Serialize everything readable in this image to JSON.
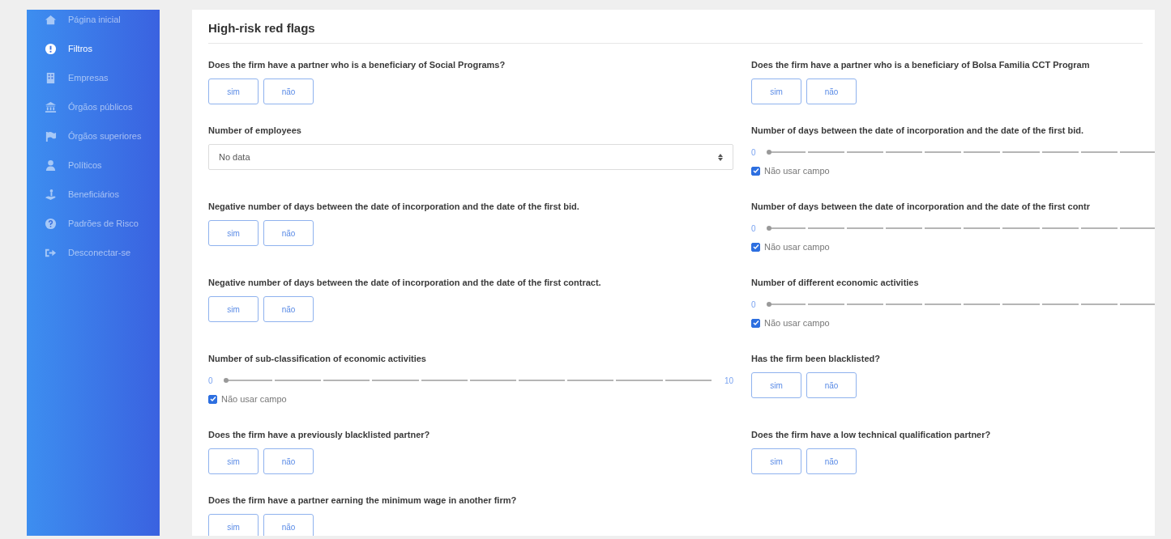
{
  "sidebar": {
    "items": [
      {
        "label": "Página inicial",
        "selected": false
      },
      {
        "label": "Filtros",
        "selected": true
      },
      {
        "label": "Empresas",
        "selected": false
      },
      {
        "label": "Órgãos públicos",
        "selected": false
      },
      {
        "label": "Órgãos superiores",
        "selected": false
      },
      {
        "label": "Políticos",
        "selected": false
      },
      {
        "label": "Beneficiários",
        "selected": false
      },
      {
        "label": "Padrões de Risco",
        "selected": false
      },
      {
        "label": "Desconectar-se",
        "selected": false
      }
    ]
  },
  "panel": {
    "title": "High-risk red flags",
    "left_column": [
      {
        "kind": "yesno",
        "label": "Does the firm have a partner who is a beneficiary of Social Programs?",
        "buttons": [
          "sim",
          "não"
        ]
      },
      {
        "kind": "select",
        "label": "Number of employees",
        "value": "No data"
      },
      {
        "kind": "yesno",
        "label": "Negative number of days between the date of incorporation and the date of the first bid.",
        "buttons": [
          "sim",
          "não"
        ]
      },
      {
        "kind": "yesno",
        "label": "Negative number of days between the date of incorporation and the date of the first contract.",
        "buttons": [
          "sim",
          "não"
        ]
      },
      {
        "kind": "slider",
        "label": "Number of sub-classification of economic activities",
        "min": "0",
        "max": "10",
        "level": 0,
        "checkbox": {
          "label": "Não usar campo",
          "checked": true
        }
      },
      {
        "kind": "yesno",
        "label": "Does the firm have a previously blacklisted partner?",
        "buttons": [
          "sim",
          "não"
        ]
      },
      {
        "kind": "yesno",
        "label": "Does the firm have a partner earning the minimum wage in another firm?",
        "buttons": [
          "sim",
          "não"
        ]
      }
    ],
    "right_column": [
      {
        "kind": "yesno",
        "label": "Does the firm have a partner who is a beneficiary of Bolsa Familia CCT Program",
        "buttons": [
          "sim",
          "não"
        ]
      },
      {
        "kind": "slider",
        "label": "Number of days between the date of incorporation and the date of the first bid.",
        "min": "0",
        "level": 0,
        "checkbox": {
          "label": "Não usar campo",
          "checked": true
        }
      },
      {
        "kind": "slider",
        "label": "Number of days between the date of incorporation and the date of the first contr",
        "min": "0",
        "level": 0,
        "checkbox": {
          "label": "Não usar campo",
          "checked": true
        }
      },
      {
        "kind": "slider",
        "label": "Number of different economic activities",
        "min": "0",
        "level": 0,
        "checkbox": {
          "label": "Não usar campo",
          "checked": true
        }
      },
      {
        "kind": "yesno",
        "label": "Has the firm been blacklisted?",
        "buttons": [
          "sim",
          "não"
        ]
      },
      {
        "kind": "yesno",
        "label": "Does the firm have a low technical qualification partner?",
        "buttons": [
          "sim",
          "não"
        ]
      }
    ]
  }
}
